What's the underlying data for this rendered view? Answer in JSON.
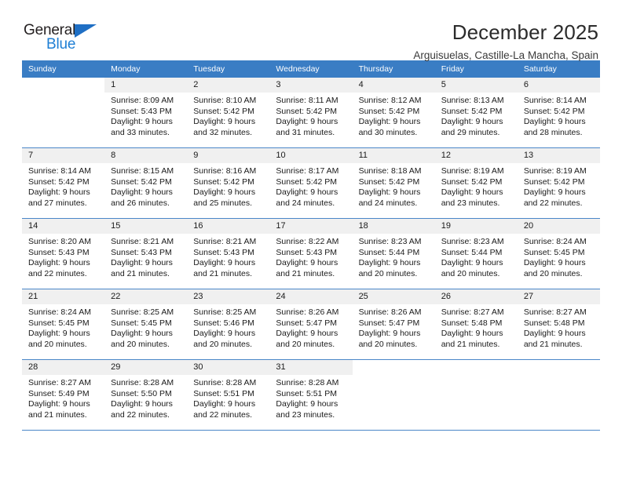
{
  "brand": {
    "name_top": "General",
    "name_bottom": "Blue",
    "triangle_icon": "brand-triangle-icon",
    "color_dark": "#231f20",
    "color_blue": "#1f7fd4"
  },
  "header": {
    "title": "December 2025",
    "subtitle": "Arguisuelas, Castille-La Mancha, Spain"
  },
  "theme": {
    "header_bg": "#3a7dc4",
    "daynum_bg": "#f0f0f0",
    "row_border": "#4a86c8"
  },
  "weekday_headers": [
    "Sunday",
    "Monday",
    "Tuesday",
    "Wednesday",
    "Thursday",
    "Friday",
    "Saturday"
  ],
  "weeks": [
    [
      {
        "day": "",
        "sunrise": "",
        "sunset": "",
        "daylight1": "",
        "daylight2": ""
      },
      {
        "day": "1",
        "sunrise": "Sunrise: 8:09 AM",
        "sunset": "Sunset: 5:43 PM",
        "daylight1": "Daylight: 9 hours",
        "daylight2": "and 33 minutes."
      },
      {
        "day": "2",
        "sunrise": "Sunrise: 8:10 AM",
        "sunset": "Sunset: 5:42 PM",
        "daylight1": "Daylight: 9 hours",
        "daylight2": "and 32 minutes."
      },
      {
        "day": "3",
        "sunrise": "Sunrise: 8:11 AM",
        "sunset": "Sunset: 5:42 PM",
        "daylight1": "Daylight: 9 hours",
        "daylight2": "and 31 minutes."
      },
      {
        "day": "4",
        "sunrise": "Sunrise: 8:12 AM",
        "sunset": "Sunset: 5:42 PM",
        "daylight1": "Daylight: 9 hours",
        "daylight2": "and 30 minutes."
      },
      {
        "day": "5",
        "sunrise": "Sunrise: 8:13 AM",
        "sunset": "Sunset: 5:42 PM",
        "daylight1": "Daylight: 9 hours",
        "daylight2": "and 29 minutes."
      },
      {
        "day": "6",
        "sunrise": "Sunrise: 8:14 AM",
        "sunset": "Sunset: 5:42 PM",
        "daylight1": "Daylight: 9 hours",
        "daylight2": "and 28 minutes."
      }
    ],
    [
      {
        "day": "7",
        "sunrise": "Sunrise: 8:14 AM",
        "sunset": "Sunset: 5:42 PM",
        "daylight1": "Daylight: 9 hours",
        "daylight2": "and 27 minutes."
      },
      {
        "day": "8",
        "sunrise": "Sunrise: 8:15 AM",
        "sunset": "Sunset: 5:42 PM",
        "daylight1": "Daylight: 9 hours",
        "daylight2": "and 26 minutes."
      },
      {
        "day": "9",
        "sunrise": "Sunrise: 8:16 AM",
        "sunset": "Sunset: 5:42 PM",
        "daylight1": "Daylight: 9 hours",
        "daylight2": "and 25 minutes."
      },
      {
        "day": "10",
        "sunrise": "Sunrise: 8:17 AM",
        "sunset": "Sunset: 5:42 PM",
        "daylight1": "Daylight: 9 hours",
        "daylight2": "and 24 minutes."
      },
      {
        "day": "11",
        "sunrise": "Sunrise: 8:18 AM",
        "sunset": "Sunset: 5:42 PM",
        "daylight1": "Daylight: 9 hours",
        "daylight2": "and 24 minutes."
      },
      {
        "day": "12",
        "sunrise": "Sunrise: 8:19 AM",
        "sunset": "Sunset: 5:42 PM",
        "daylight1": "Daylight: 9 hours",
        "daylight2": "and 23 minutes."
      },
      {
        "day": "13",
        "sunrise": "Sunrise: 8:19 AM",
        "sunset": "Sunset: 5:42 PM",
        "daylight1": "Daylight: 9 hours",
        "daylight2": "and 22 minutes."
      }
    ],
    [
      {
        "day": "14",
        "sunrise": "Sunrise: 8:20 AM",
        "sunset": "Sunset: 5:43 PM",
        "daylight1": "Daylight: 9 hours",
        "daylight2": "and 22 minutes."
      },
      {
        "day": "15",
        "sunrise": "Sunrise: 8:21 AM",
        "sunset": "Sunset: 5:43 PM",
        "daylight1": "Daylight: 9 hours",
        "daylight2": "and 21 minutes."
      },
      {
        "day": "16",
        "sunrise": "Sunrise: 8:21 AM",
        "sunset": "Sunset: 5:43 PM",
        "daylight1": "Daylight: 9 hours",
        "daylight2": "and 21 minutes."
      },
      {
        "day": "17",
        "sunrise": "Sunrise: 8:22 AM",
        "sunset": "Sunset: 5:43 PM",
        "daylight1": "Daylight: 9 hours",
        "daylight2": "and 21 minutes."
      },
      {
        "day": "18",
        "sunrise": "Sunrise: 8:23 AM",
        "sunset": "Sunset: 5:44 PM",
        "daylight1": "Daylight: 9 hours",
        "daylight2": "and 20 minutes."
      },
      {
        "day": "19",
        "sunrise": "Sunrise: 8:23 AM",
        "sunset": "Sunset: 5:44 PM",
        "daylight1": "Daylight: 9 hours",
        "daylight2": "and 20 minutes."
      },
      {
        "day": "20",
        "sunrise": "Sunrise: 8:24 AM",
        "sunset": "Sunset: 5:45 PM",
        "daylight1": "Daylight: 9 hours",
        "daylight2": "and 20 minutes."
      }
    ],
    [
      {
        "day": "21",
        "sunrise": "Sunrise: 8:24 AM",
        "sunset": "Sunset: 5:45 PM",
        "daylight1": "Daylight: 9 hours",
        "daylight2": "and 20 minutes."
      },
      {
        "day": "22",
        "sunrise": "Sunrise: 8:25 AM",
        "sunset": "Sunset: 5:45 PM",
        "daylight1": "Daylight: 9 hours",
        "daylight2": "and 20 minutes."
      },
      {
        "day": "23",
        "sunrise": "Sunrise: 8:25 AM",
        "sunset": "Sunset: 5:46 PM",
        "daylight1": "Daylight: 9 hours",
        "daylight2": "and 20 minutes."
      },
      {
        "day": "24",
        "sunrise": "Sunrise: 8:26 AM",
        "sunset": "Sunset: 5:47 PM",
        "daylight1": "Daylight: 9 hours",
        "daylight2": "and 20 minutes."
      },
      {
        "day": "25",
        "sunrise": "Sunrise: 8:26 AM",
        "sunset": "Sunset: 5:47 PM",
        "daylight1": "Daylight: 9 hours",
        "daylight2": "and 20 minutes."
      },
      {
        "day": "26",
        "sunrise": "Sunrise: 8:27 AM",
        "sunset": "Sunset: 5:48 PM",
        "daylight1": "Daylight: 9 hours",
        "daylight2": "and 21 minutes."
      },
      {
        "day": "27",
        "sunrise": "Sunrise: 8:27 AM",
        "sunset": "Sunset: 5:48 PM",
        "daylight1": "Daylight: 9 hours",
        "daylight2": "and 21 minutes."
      }
    ],
    [
      {
        "day": "28",
        "sunrise": "Sunrise: 8:27 AM",
        "sunset": "Sunset: 5:49 PM",
        "daylight1": "Daylight: 9 hours",
        "daylight2": "and 21 minutes."
      },
      {
        "day": "29",
        "sunrise": "Sunrise: 8:28 AM",
        "sunset": "Sunset: 5:50 PM",
        "daylight1": "Daylight: 9 hours",
        "daylight2": "and 22 minutes."
      },
      {
        "day": "30",
        "sunrise": "Sunrise: 8:28 AM",
        "sunset": "Sunset: 5:51 PM",
        "daylight1": "Daylight: 9 hours",
        "daylight2": "and 22 minutes."
      },
      {
        "day": "31",
        "sunrise": "Sunrise: 8:28 AM",
        "sunset": "Sunset: 5:51 PM",
        "daylight1": "Daylight: 9 hours",
        "daylight2": "and 23 minutes."
      },
      {
        "day": "",
        "sunrise": "",
        "sunset": "",
        "daylight1": "",
        "daylight2": ""
      },
      {
        "day": "",
        "sunrise": "",
        "sunset": "",
        "daylight1": "",
        "daylight2": ""
      },
      {
        "day": "",
        "sunrise": "",
        "sunset": "",
        "daylight1": "",
        "daylight2": ""
      }
    ]
  ]
}
